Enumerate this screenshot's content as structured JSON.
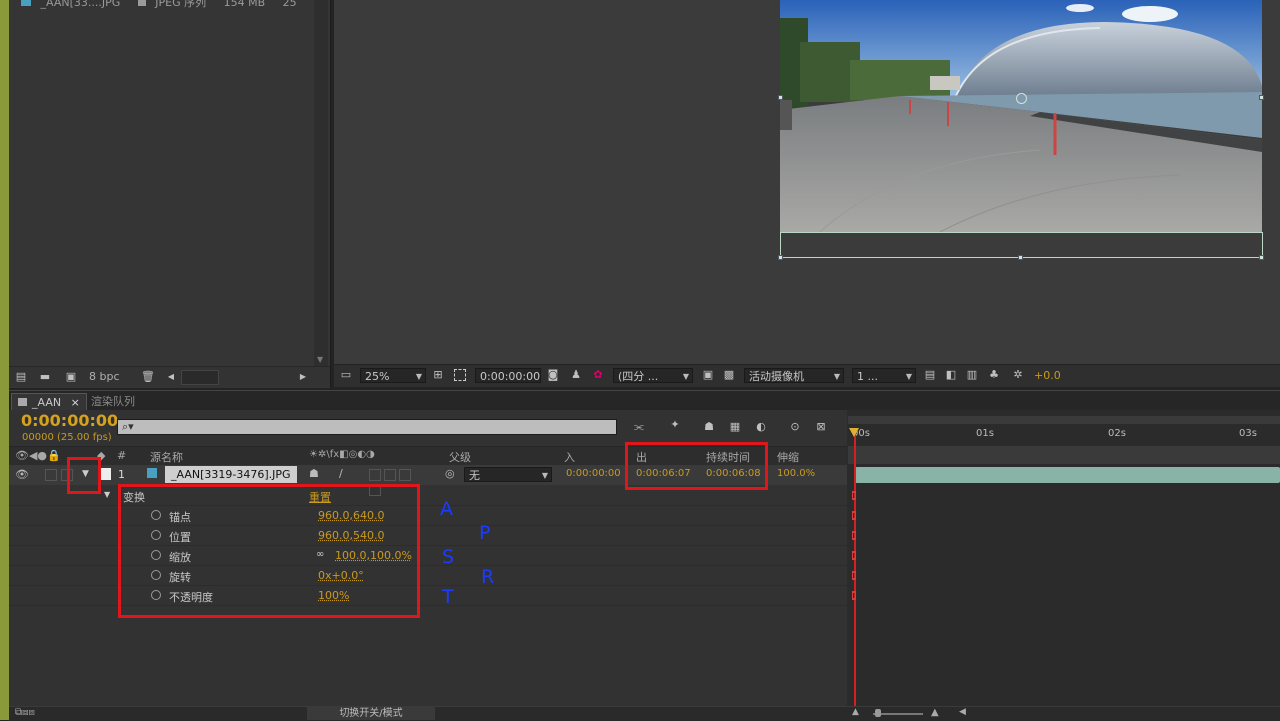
{
  "project": {
    "file_name": "_AAN[33....JPG",
    "file_type": "JPEG 序列",
    "file_size": "154 MB",
    "file_extra": "25",
    "bpc": "8 bpc"
  },
  "comp_toolbar": {
    "zoom": "25%",
    "timecode": "0:00:00:00",
    "resolution": "(四分 ...",
    "camera": "活动摄像机",
    "views": "1 ...",
    "exposure": "+0.0"
  },
  "tabs": {
    "comp_tab": "_AAN",
    "render_tab": "渲染队列"
  },
  "timeline": {
    "current_time": "0:00:00:00",
    "frame_info": "00000 (25.00 fps)",
    "search_placeholder": "",
    "headers": {
      "num": "#",
      "source": "源名称",
      "parent": "父级",
      "in": "入",
      "out": "出",
      "duration": "持续时间",
      "stretch": "伸缩"
    },
    "layer": {
      "index": "1",
      "name": "_AAN[3319-3476].JPG",
      "parent": "无",
      "in": "0:00:00:00",
      "out": "0:00:06:07",
      "duration": "0:00:06:08",
      "stretch": "100.0%"
    },
    "transform": {
      "label": "变换",
      "reset": "重置",
      "props": [
        {
          "label": "锚点",
          "value": "960.0,640.0"
        },
        {
          "label": "位置",
          "value": "960.0,540.0"
        },
        {
          "label": "缩放",
          "value": "100.0,100.0%"
        },
        {
          "label": "旋转",
          "value": "0x+0.0°"
        },
        {
          "label": "不透明度",
          "value": "100%"
        }
      ]
    },
    "ruler_labels": [
      "00s",
      "01s",
      "02s",
      "03s"
    ],
    "toggle_label": "切换开关/模式"
  },
  "annotations": {
    "letters": [
      "A",
      "P",
      "S",
      "R",
      "T"
    ],
    "box_color": "#e0161a",
    "letter_color": "#1a3cff"
  }
}
